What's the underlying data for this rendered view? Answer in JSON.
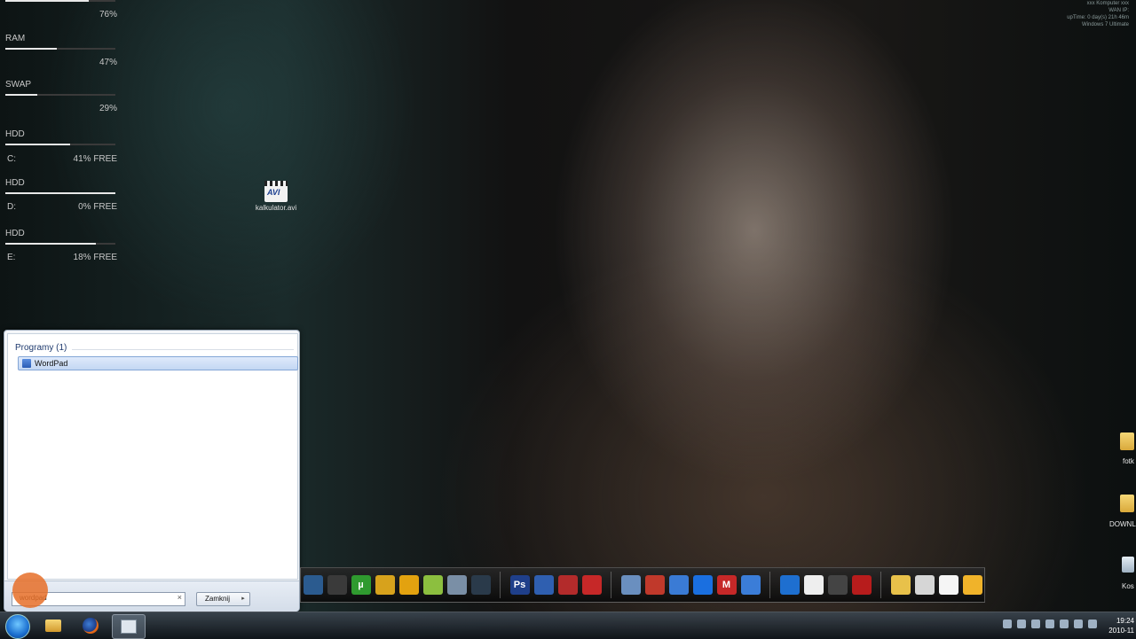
{
  "gadget": {
    "top_value": "76%",
    "top_fill": 0.76,
    "ram": {
      "label": "RAM",
      "value": "47%",
      "fill": 0.47
    },
    "swap": {
      "label": "SWAP",
      "value": "29%",
      "fill": 0.29
    },
    "drives": [
      {
        "label": "HDD",
        "drive": "C:",
        "value": "41% FREE",
        "fill": 0.59
      },
      {
        "label": "HDD",
        "drive": "D:",
        "value": "0% FREE",
        "fill": 1.0
      },
      {
        "label": "HDD",
        "drive": "E:",
        "value": "18% FREE",
        "fill": 0.82
      }
    ]
  },
  "desktop": {
    "avi_icon_label": "kalkulator.avi",
    "avi_badge": "AVI",
    "right_labels": [
      "fotk",
      "DOWNL",
      "Kos"
    ]
  },
  "sysinfo": {
    "line1": "xxx Komputer xxx",
    "line2": "WAN IP:",
    "line3": "upTime: 0 day(s) 21h 46m",
    "line4": "Windows 7 Ultimate"
  },
  "start_menu": {
    "section_header": "Programy (1)",
    "result_item": "WordPad",
    "search_value": "wordpad",
    "clear_glyph": "×",
    "shutdown_label": "Zamknij",
    "shutdown_arrow": "▸"
  },
  "dock_icons": [
    "steam-icon",
    "steam-icon-2",
    "utorrent-icon",
    "tool-icon",
    "aimp-icon",
    "notepadpp-icon",
    "virtualbox-icon",
    "game-icon",
    "photoshop-icon",
    "word-icon",
    "outlook-icon",
    "scissors-icon",
    "tools-icon",
    "nero-icon",
    "chart-icon",
    "speed-icon",
    "malwarebytes-icon",
    "internet-icon",
    "skype-icon",
    "football-icon",
    "network-icon",
    "mbot-icon",
    "folder-icon",
    "pencil-icon",
    "notepad-icon",
    "launcher-icon"
  ],
  "taskbar": {
    "clock_time": "19:24",
    "clock_date": "2010-11"
  }
}
